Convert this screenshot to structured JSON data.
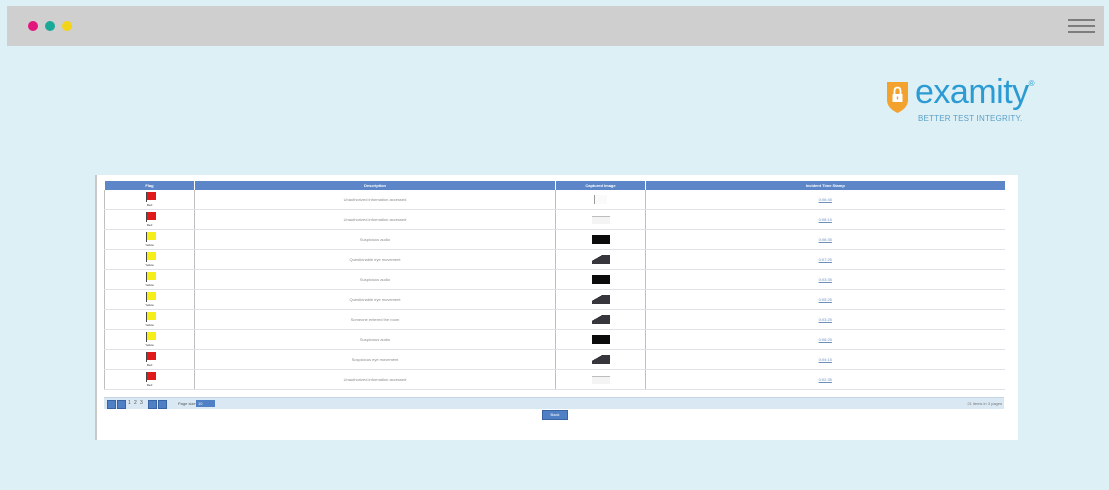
{
  "window": {
    "dots": [
      {
        "name": "close",
        "color": "#e2167d"
      },
      {
        "name": "minimize",
        "color": "#19a996"
      },
      {
        "name": "maximize",
        "color": "#f2d418"
      }
    ],
    "menu_icon": "hamburger-menu-icon"
  },
  "logo": {
    "brand": "examity",
    "registered": "®",
    "tagline": "BETTER TEST INTEGRITY.",
    "brand_color": "#2c9bd3",
    "shield_color": "#f2a22d"
  },
  "table": {
    "columns": [
      "Flag",
      "Description",
      "Captured Image",
      "Incident Time Stamp"
    ],
    "rows": [
      {
        "flag": "Red",
        "flag_color": "#e01a1a",
        "description": "Unauthorized information accessed",
        "image": "line",
        "timestamp": "0:06:45"
      },
      {
        "flag": "Red",
        "flag_color": "#e01a1a",
        "description": "Unauthorized information accessed",
        "image": "white",
        "timestamp": "0:08:15"
      },
      {
        "flag": "Yellow",
        "flag_color": "#f5ee1a",
        "description": "Suspicious audio",
        "image": "black",
        "timestamp": "0:06:35"
      },
      {
        "flag": "Yellow",
        "flag_color": "#f5ee1a",
        "description": "Questionable eye movement",
        "image": "cam",
        "timestamp": "0:07:25"
      },
      {
        "flag": "Yellow",
        "flag_color": "#f5ee1a",
        "description": "Suspicious audio",
        "image": "black",
        "timestamp": "0:03:35"
      },
      {
        "flag": "Yellow",
        "flag_color": "#f5ee1a",
        "description": "Questionable eye movement",
        "image": "cam",
        "timestamp": "0:05:25"
      },
      {
        "flag": "Yellow",
        "flag_color": "#f5ee1a",
        "description": "Someone entered the room",
        "image": "cam",
        "timestamp": "0:03:25"
      },
      {
        "flag": "Yellow",
        "flag_color": "#f5ee1a",
        "description": "Suspicious audio",
        "image": "black",
        "timestamp": "0:06:25"
      },
      {
        "flag": "Red",
        "flag_color": "#e01a1a",
        "description": "Suspicious eye movement",
        "image": "cam",
        "timestamp": "0:04:15"
      },
      {
        "flag": "Red",
        "flag_color": "#e01a1a",
        "description": "Unauthorized information accessed",
        "image": "white",
        "timestamp": "0:02:35"
      }
    ]
  },
  "pager": {
    "first_icon": "first-page-icon",
    "prev_icon": "prev-page-icon",
    "next_icon": "next-page-icon",
    "last_icon": "last-page-icon",
    "pages": [
      "1",
      "2",
      "3"
    ],
    "page_size_label": "Page size:",
    "page_size_value": "10",
    "summary": "21 items in 3 pages"
  },
  "back_button": "Back"
}
